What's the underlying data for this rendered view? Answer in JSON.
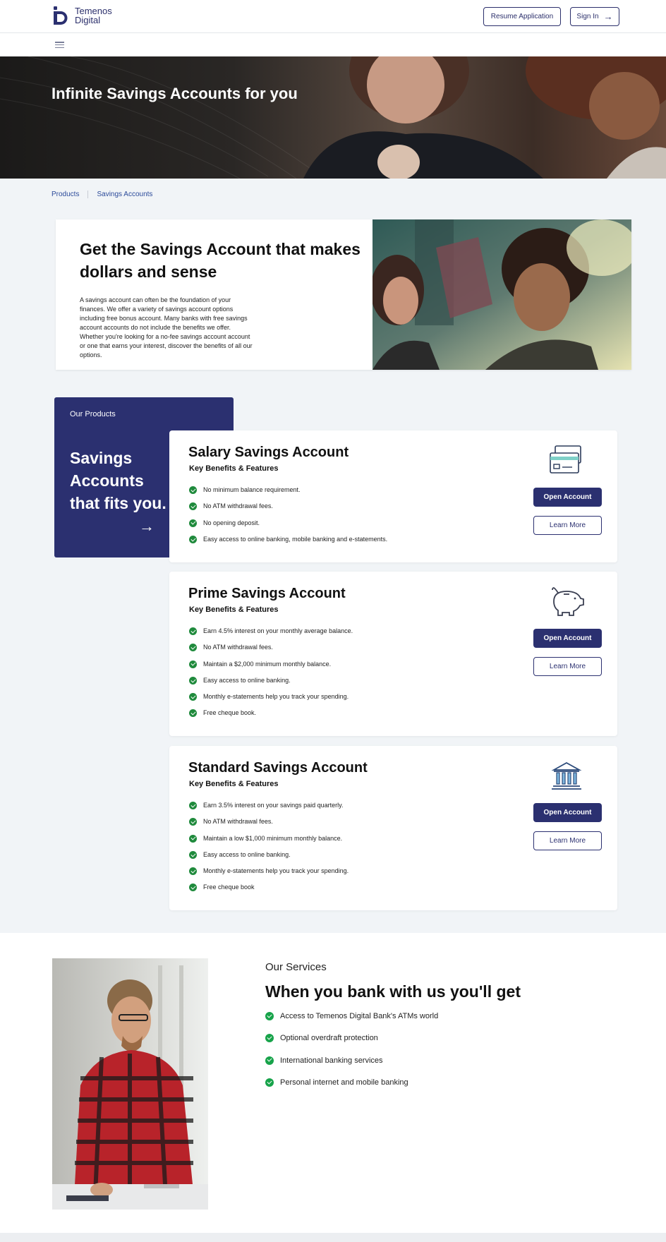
{
  "header": {
    "brand_line1": "Temenos",
    "brand_line2": "Digital",
    "resume_label": "Resume Application",
    "signin_label": "Sign In",
    "brand_color": "#2b3070"
  },
  "hero": {
    "title": "Infinite Savings Accounts for you"
  },
  "breadcrumb": {
    "items": [
      "Products",
      "Savings Accounts"
    ]
  },
  "intro": {
    "title": "Get the Savings Account  that makes dollars and sense",
    "body": "A savings account can often be the foundation of your finances. We offer a variety of savings account options including free bonus account. Many banks with free savings account accounts do not include the benefits we offer. Whether you're looking for a no-fee savings account account or one that earns your interest, discover the benefits of all our options."
  },
  "products": {
    "label": "Our Products",
    "title": "Savings Accounts that fits you."
  },
  "accounts": [
    {
      "title": "Salary Savings Account",
      "subtitle": "Key Benefits & Features",
      "icon": "credit-card-icon",
      "features": [
        "No minimum balance requirement.",
        "No ATM withdrawal fees.",
        "No opening deposit.",
        "Easy access to online banking, mobile banking and e-statements."
      ],
      "open_label": "Open Account",
      "learn_label": "Learn More"
    },
    {
      "title": "Prime Savings Account",
      "subtitle": "Key Benefits & Features",
      "icon": "piggy-bank-icon",
      "features": [
        "Earn 4.5% interest on your monthly average balance.",
        "No ATM withdrawal fees.",
        "Maintain a $2,000 minimum monthly balance.",
        "Easy access to online banking.",
        "Monthly e-statements help you track your spending.",
        "Free cheque book."
      ],
      "open_label": "Open Account",
      "learn_label": "Learn More"
    },
    {
      "title": "Standard Savings Account",
      "subtitle": "Key Benefits & Features",
      "icon": "bank-building-icon",
      "features": [
        "Earn 3.5% interest on your savings paid quarterly.",
        "No ATM withdrawal fees.",
        "Maintain a low $1,000 minimum monthly balance.",
        "Easy access to online banking.",
        "Monthly e-statements help you track your spending.",
        "Free cheque book"
      ],
      "open_label": "Open Account",
      "learn_label": "Learn More"
    }
  ],
  "services": {
    "label": "Our Services",
    "title": "When you bank with us you'll get",
    "items": [
      "Access to Temenos Digital Bank's ATMs world",
      "Optional overdraft protection",
      "International banking services",
      "Personal internet and mobile banking"
    ]
  }
}
